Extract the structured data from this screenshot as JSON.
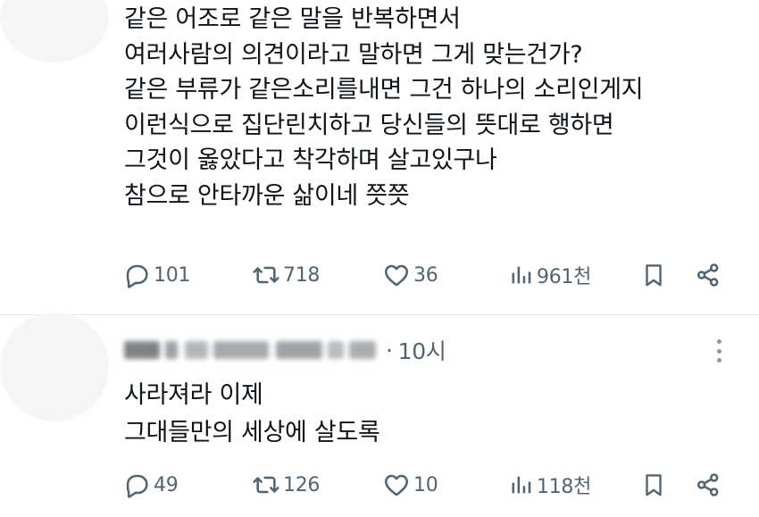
{
  "tweet1": {
    "lines": [
      "같은 어조로 같은 말을 반복하면서",
      "여러사람의 의견이라고 말하면 그게 맞는건가?",
      "같은 부류가 같은소리를내면 그건 하나의 소리인게지",
      "이런식으로 집단린치하고 당신들의 뜻대로 행하면",
      "그것이 옳았다고 착각하며 살고있구나",
      "참으로 안타까운 삶이네 쯧쯧"
    ],
    "actions": {
      "replies": "101",
      "reposts": "718",
      "likes": "36",
      "views": "961천"
    }
  },
  "tweet2": {
    "author_blurred": true,
    "time": "10시",
    "separator": "·",
    "lines": [
      "사라져라 이제",
      "그대들만의 세상에 살도록"
    ],
    "actions": {
      "replies": "49",
      "reposts": "126",
      "likes": "10",
      "views": "118천"
    }
  },
  "icons": {
    "reply": "reply-bubble-icon",
    "repost": "repost-arrows-icon",
    "like": "heart-icon",
    "views": "views-bar-chart-icon",
    "bookmark": "bookmark-icon",
    "share": "share-icon",
    "more": "more-vertical-dots-icon"
  },
  "colors": {
    "text": "#0f1419",
    "muted": "#536471",
    "divider": "#e4e8eb"
  }
}
